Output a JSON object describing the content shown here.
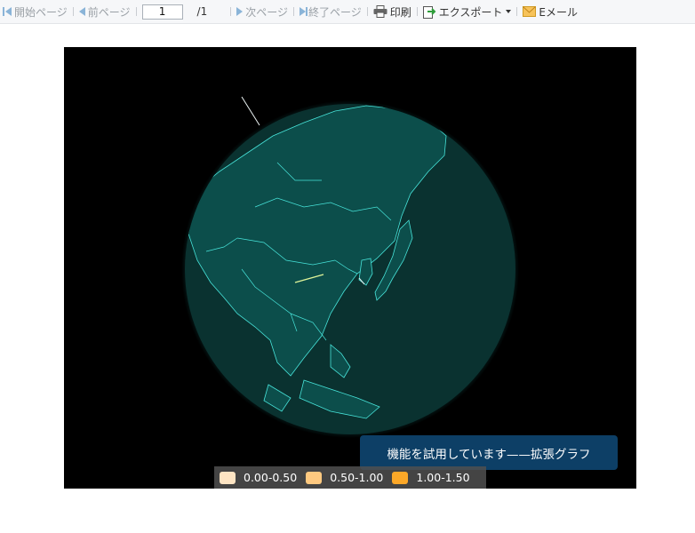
{
  "toolbar": {
    "first_page": "開始ページ",
    "prev_page": "前ページ",
    "page_value": "1",
    "page_total": "/1",
    "next_page": "次ページ",
    "last_page": "終了ページ",
    "print": "印刷",
    "export": "エクスポート",
    "email": "Eメール"
  },
  "chart": {
    "tooltip": "機能を試用しています——拡張グラフ",
    "legend": [
      {
        "label": "0.00-0.50",
        "color": "#fde4c3"
      },
      {
        "label": "0.50-1.00",
        "color": "#fec980"
      },
      {
        "label": "1.00-1.50",
        "color": "#fca828"
      }
    ],
    "globe_color": "#0b3d3b",
    "border_color": "#41e2d8"
  }
}
